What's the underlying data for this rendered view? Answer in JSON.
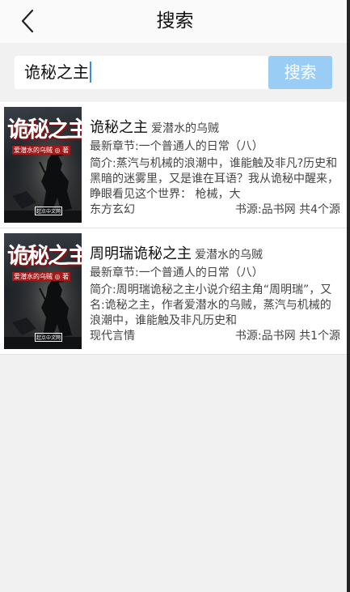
{
  "header": {
    "title": "搜索"
  },
  "search": {
    "query": "诡秘之主",
    "button_label": "搜索"
  },
  "results": [
    {
      "title": "诡秘之主",
      "author": "爱潜水的乌贼",
      "latest": "最新章节:一个普通人的日常（八）",
      "intro": "简介:蒸汽与机械的浪潮中，谁能触及非凡?历史和黑暗的迷雾里，又是谁在耳语？我从诡秘中醒来，睁眼看见这个世界：  枪械，大",
      "category": "东方玄幻",
      "source": "书源:品书网 共4个源",
      "cover": {
        "title": "诡秘之主",
        "subtitle": "爱潜水的乌贼 ◎ 著",
        "publisher": "起点中文网"
      }
    },
    {
      "title": "周明瑞诡秘之主",
      "author": "爱潜水的乌贼",
      "latest": "最新章节:一个普通人的日常（八）",
      "intro": "简介:周明瑞诡秘之主小说介绍主角“周明瑞”，又名:诡秘之主，作者爱潜水的乌贼，蒸汽与机械的浪潮中，谁能触及非凡历史和",
      "category": "现代言情",
      "source": "书源:品书网 共1个源",
      "cover": {
        "title": "诡秘之主",
        "subtitle": "爱潜水的乌贼 ◎ 著",
        "publisher": "起点中文网"
      }
    }
  ]
}
